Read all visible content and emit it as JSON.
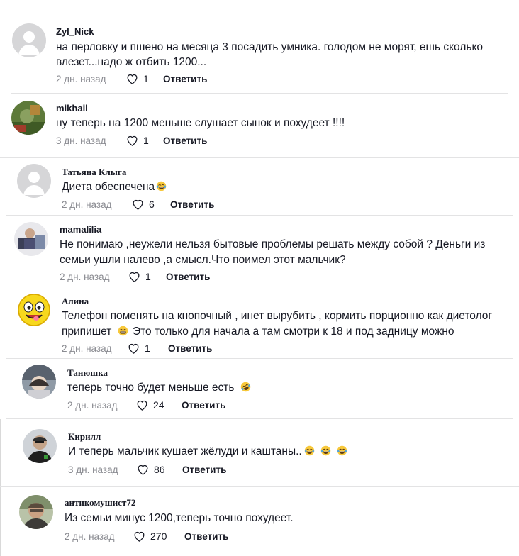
{
  "comments": [
    {
      "username": "Zyl_Nick",
      "lines": [
        "на перловку и пшено на месяца 3 посадить умника. голодом не морят, ешь сколько",
        "влезет...надо ж отбить 1200..."
      ],
      "date": "2 дн. назад",
      "likes": "1",
      "reply_label": "Ответить",
      "avatar": "default-avatar"
    },
    {
      "username": "mikhail",
      "lines": [
        "ну теперь на 1200 меньше слушает сынок и похудеет !!!!"
      ],
      "date": "3 дн. назад",
      "likes": "1",
      "reply_label": "Ответить",
      "avatar": "photo-avatar"
    },
    {
      "username": "Татьяна Клыга",
      "lines": [
        "Диета обеспечена"
      ],
      "emojis": [
        "laughing-emoji"
      ],
      "date": "2 дн. назад",
      "likes": "6",
      "reply_label": "Ответить",
      "avatar": "default-avatar"
    },
    {
      "username": "mamalilia",
      "lines": [
        "Не понимаю ,неужели нельзя бытовые проблемы решать между собой ? Деньги из",
        "семьи ушли налево ,а смысл.Что поимел этот мальчик?"
      ],
      "date": "2 дн. назад",
      "likes": "1",
      "reply_label": "Ответить",
      "avatar": "photo-avatar"
    },
    {
      "username": "Алина",
      "lines": [
        "Телефон поменять на кнопочный , инет вырубить , кормить порционно как диетолог",
        "припишет",
        " Это только для начала а там смотри к 18 и под задницу можно"
      ],
      "emojis": [
        "grin-emoji"
      ],
      "date": "2 дн. назад",
      "likes": "1",
      "reply_label": "Ответить",
      "avatar": "smiley-avatar"
    },
    {
      "username": "Танюшка",
      "lines": [
        "теперь точно будет меньше есть"
      ],
      "emojis": [
        "rofl-emoji"
      ],
      "date": "2 дн. назад",
      "likes": "24",
      "reply_label": "Ответить",
      "avatar": "photo-avatar"
    },
    {
      "username": "Кирилл",
      "lines": [
        "И теперь мальчик кушает жёлуди и каштаны.."
      ],
      "emojis": [
        "laughing-emoji",
        "laughing-emoji",
        "laughing-emoji"
      ],
      "date": "3 дн. назад",
      "likes": "86",
      "reply_label": "Ответить",
      "avatar": "photo-avatar"
    },
    {
      "username": "антикомушист72",
      "lines": [
        "Из семьи минус 1200,теперь точно похудеет."
      ],
      "date": "2 дн. назад",
      "likes": "270",
      "reply_label": "Ответить",
      "avatar": "photo-avatar"
    }
  ],
  "colors": {
    "meta": "#8a8b91",
    "text": "#161823",
    "avatar_gray": "#d6d6d8",
    "emoji_yellow": "#f7c83a"
  }
}
